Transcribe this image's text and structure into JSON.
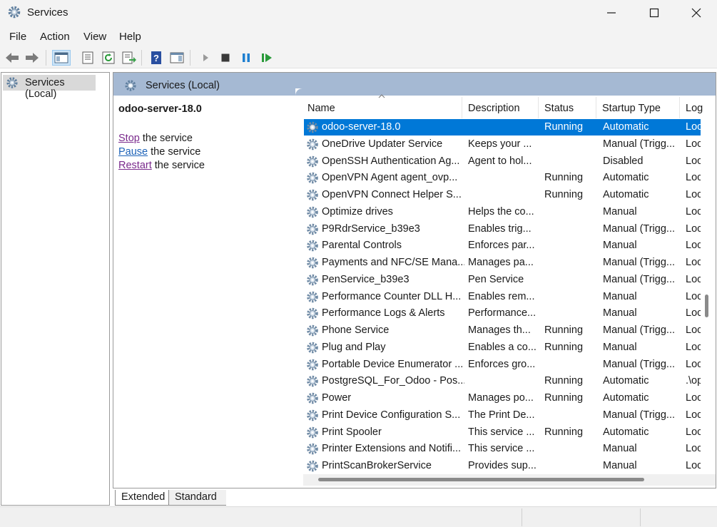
{
  "window": {
    "title": "Services",
    "app_icon": "services-gear-icon",
    "controls": [
      "minimize-icon",
      "maximize-icon",
      "close-icon"
    ]
  },
  "menu": [
    "File",
    "Action",
    "View",
    "Help"
  ],
  "toolbar": {
    "buttons": [
      "back-arrow-icon",
      "forward-arrow-icon",
      "show-hide-console-tree-icon",
      "properties-icon",
      "refresh-icon",
      "export-list-icon",
      "help-icon",
      "show-hide-action-pane-icon",
      "start-service-icon",
      "stop-service-icon",
      "pause-service-icon",
      "restart-service-icon"
    ]
  },
  "tree": {
    "root": "Services (Local)"
  },
  "pane_header": "Services (Local)",
  "detail": {
    "service_name": "odoo-server-18.0",
    "actions": [
      {
        "link": "Stop",
        "suffix": " the service"
      },
      {
        "link": "Pause",
        "suffix": " the service"
      },
      {
        "link": "Restart",
        "suffix": " the service"
      }
    ]
  },
  "columns": {
    "name": "Name",
    "description": "Description",
    "status": "Status",
    "startup_type": "Startup Type",
    "log_on_as": "Log"
  },
  "rows": [
    {
      "name": "odoo-server-18.0",
      "description": "",
      "status": "Running",
      "startup": "Automatic",
      "logon": "Loc",
      "selected": true
    },
    {
      "name": "OneDrive Updater Service",
      "description": "Keeps your ...",
      "status": "",
      "startup": "Manual (Trigg...",
      "logon": "Loc"
    },
    {
      "name": "OpenSSH Authentication Ag...",
      "description": "Agent to hol...",
      "status": "",
      "startup": "Disabled",
      "logon": "Loc"
    },
    {
      "name": "OpenVPN Agent agent_ovp...",
      "description": "",
      "status": "Running",
      "startup": "Automatic",
      "logon": "Loc"
    },
    {
      "name": "OpenVPN Connect Helper S...",
      "description": "",
      "status": "Running",
      "startup": "Automatic",
      "logon": "Loc"
    },
    {
      "name": "Optimize drives",
      "description": "Helps the co...",
      "status": "",
      "startup": "Manual",
      "logon": "Loc"
    },
    {
      "name": "P9RdrService_b39e3",
      "description": "Enables trig...",
      "status": "",
      "startup": "Manual (Trigg...",
      "logon": "Loc"
    },
    {
      "name": "Parental Controls",
      "description": "Enforces par...",
      "status": "",
      "startup": "Manual",
      "logon": "Loc"
    },
    {
      "name": "Payments and NFC/SE Mana...",
      "description": "Manages pa...",
      "status": "",
      "startup": "Manual (Trigg...",
      "logon": "Loc"
    },
    {
      "name": "PenService_b39e3",
      "description": "Pen Service",
      "status": "",
      "startup": "Manual (Trigg...",
      "logon": "Loc"
    },
    {
      "name": "Performance Counter DLL H...",
      "description": "Enables rem...",
      "status": "",
      "startup": "Manual",
      "logon": "Loc"
    },
    {
      "name": "Performance Logs & Alerts",
      "description": "Performance...",
      "status": "",
      "startup": "Manual",
      "logon": "Loc"
    },
    {
      "name": "Phone Service",
      "description": "Manages th...",
      "status": "Running",
      "startup": "Manual (Trigg...",
      "logon": "Loc"
    },
    {
      "name": "Plug and Play",
      "description": "Enables a co...",
      "status": "Running",
      "startup": "Manual",
      "logon": "Loc"
    },
    {
      "name": "Portable Device Enumerator ...",
      "description": "Enforces gro...",
      "status": "",
      "startup": "Manual (Trigg...",
      "logon": "Loc"
    },
    {
      "name": "PostgreSQL_For_Odoo - Pos...",
      "description": "",
      "status": "Running",
      "startup": "Automatic",
      "logon": ".\\op"
    },
    {
      "name": "Power",
      "description": "Manages po...",
      "status": "Running",
      "startup": "Automatic",
      "logon": "Loc"
    },
    {
      "name": "Print Device Configuration S...",
      "description": "The Print De...",
      "status": "",
      "startup": "Manual (Trigg...",
      "logon": "Loc"
    },
    {
      "name": "Print Spooler",
      "description": "This service ...",
      "status": "Running",
      "startup": "Automatic",
      "logon": "Loc"
    },
    {
      "name": "Printer Extensions and Notifi...",
      "description": "This service ...",
      "status": "",
      "startup": "Manual",
      "logon": "Loc"
    },
    {
      "name": "PrintScanBrokerService",
      "description": "Provides sup...",
      "status": "",
      "startup": "Manual",
      "logon": "Loc"
    }
  ],
  "tabs": [
    "Extended",
    "Standard"
  ],
  "colors": {
    "selection": "#0078d7",
    "pane_header": "#a5b9d3",
    "link_visited": "#7a2a8c",
    "link": "#1e63b8"
  }
}
